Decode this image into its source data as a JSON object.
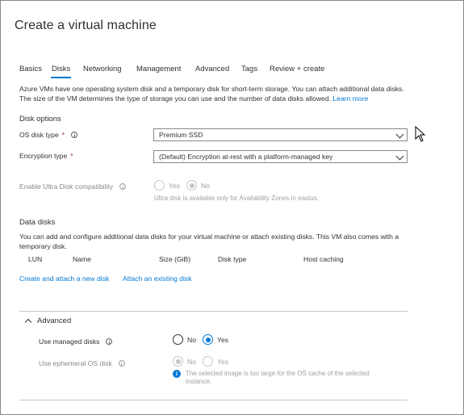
{
  "page": {
    "title": "Create a virtual machine"
  },
  "tabs": [
    {
      "label": "Basics",
      "active": false
    },
    {
      "label": "Disks",
      "active": true
    },
    {
      "label": "Networking",
      "active": false
    },
    {
      "label": "Management",
      "active": false
    },
    {
      "label": "Advanced",
      "active": false
    },
    {
      "label": "Tags",
      "active": false
    },
    {
      "label": "Review + create",
      "active": false
    }
  ],
  "intro": {
    "text": "Azure VMs have one operating system disk and a temporary disk for short-term storage. You can attach additional data disks. The size of the VM determines the type of storage you can use and the number of data disks allowed.",
    "link": "Learn more"
  },
  "disk_options": {
    "heading": "Disk options",
    "os_disk_type": {
      "label": "OS disk type",
      "required": "*",
      "value": "Premium SSD"
    },
    "encryption_type": {
      "label": "Encryption type",
      "required": "*",
      "value": "(Default) Encryption at-rest with a platform-managed key"
    },
    "ultra_disk": {
      "label": "Enable Ultra Disk compatibility",
      "yes": "Yes",
      "no": "No",
      "selected": "No",
      "note": "Ultra disk is available only for Availability Zones in eastus."
    }
  },
  "data_disks": {
    "heading": "Data disks",
    "description": "You can add and configure additional data disks for your virtual machine or attach existing disks. This VM also comes with a temporary disk.",
    "columns": [
      "LUN",
      "Name",
      "Size (GiB)",
      "Disk type",
      "Host caching"
    ],
    "create_link": "Create and attach a new disk",
    "attach_link": "Attach an existing disk"
  },
  "advanced": {
    "heading": "Advanced",
    "managed_disks": {
      "label": "Use managed disks",
      "no": "No",
      "yes": "Yes",
      "selected": "Yes"
    },
    "ephemeral_disk": {
      "label": "Use ephemeral OS disk",
      "no": "No",
      "yes": "Yes",
      "selected": "No",
      "info": "The selected image is too large for the OS cache of the selected instance."
    }
  },
  "colors": {
    "accent": "#0078d4",
    "required": "#a4262c",
    "disabled": "#a19f9d"
  }
}
